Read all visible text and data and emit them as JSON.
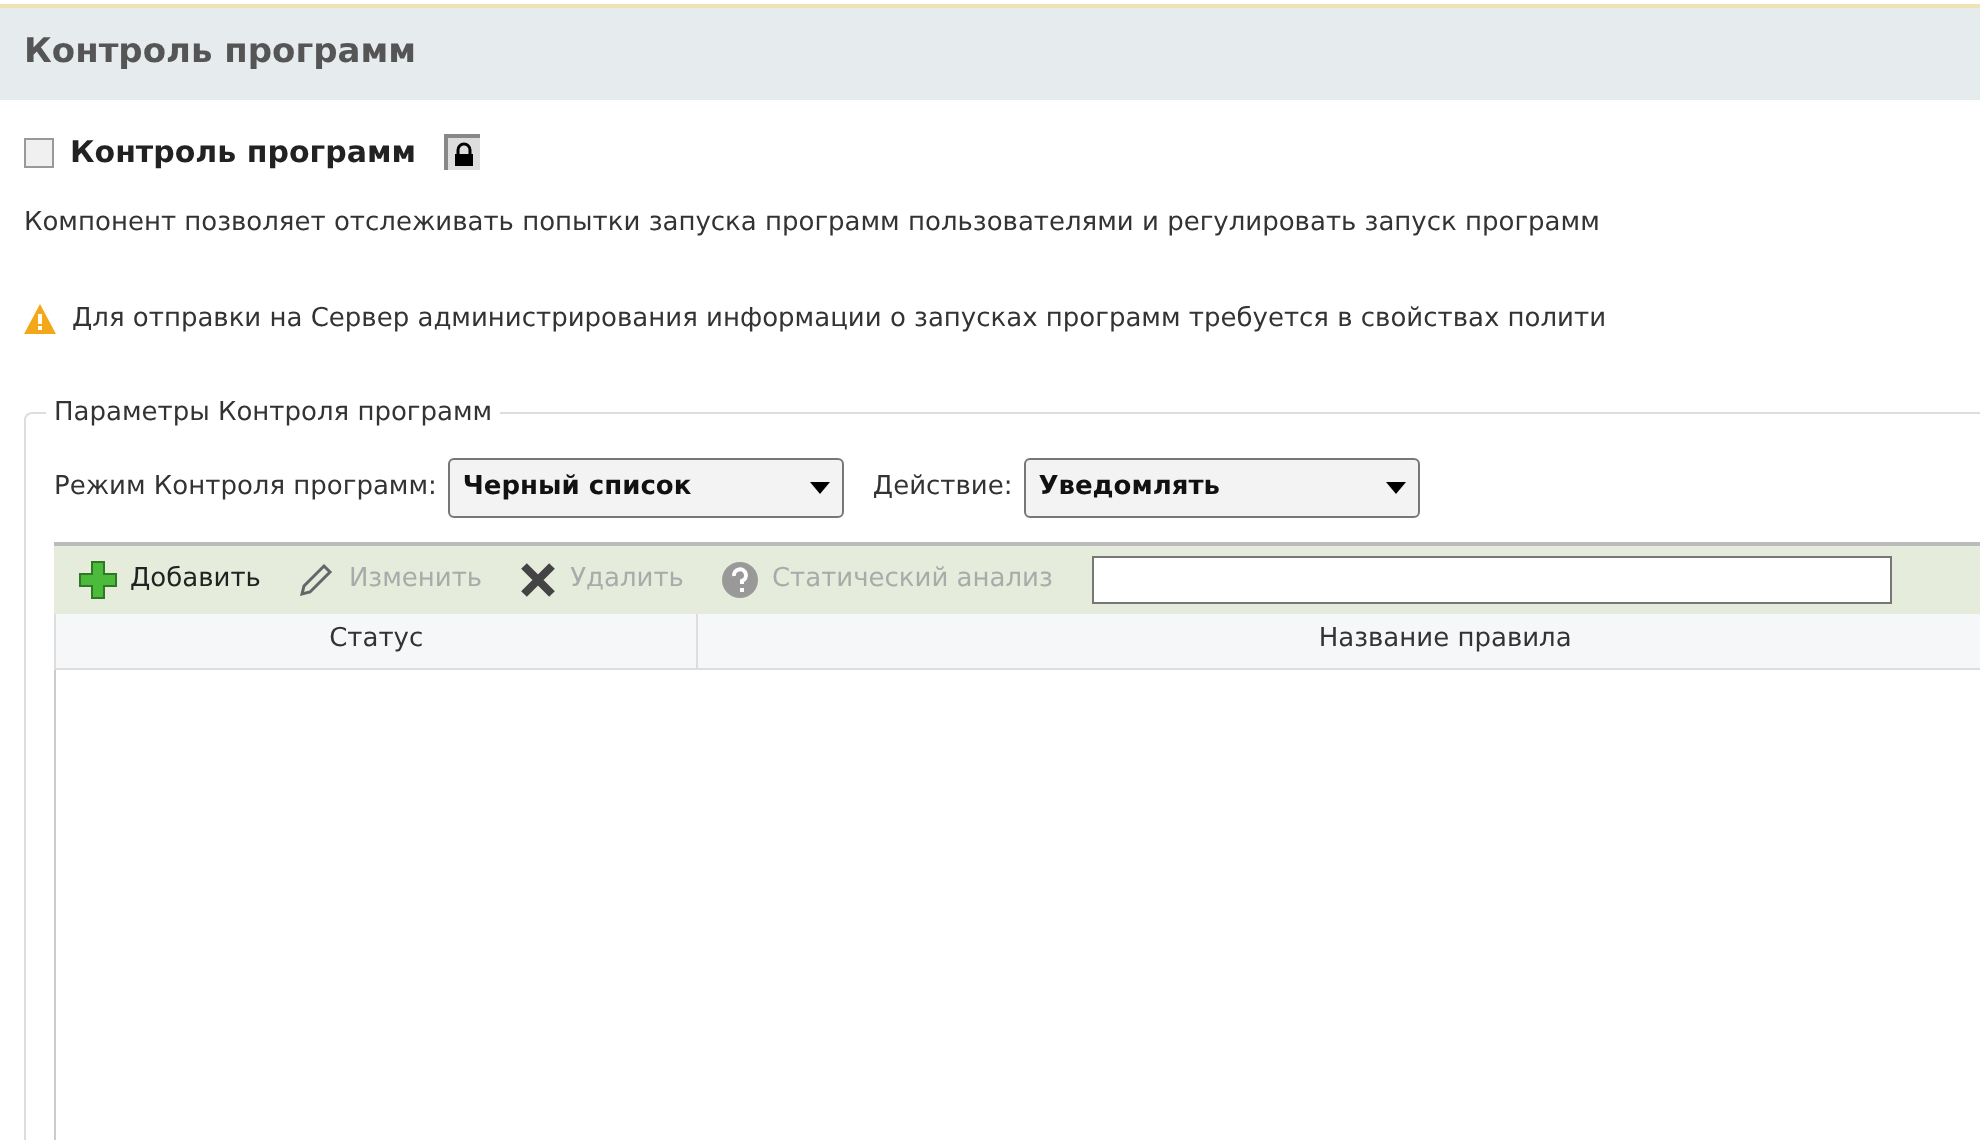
{
  "page_title": "Контроль программ",
  "component": {
    "label": "Контроль программ",
    "checked": false,
    "locked": true
  },
  "description": "Компонент позволяет отслеживать попытки запуска программ пользователями и регулировать запуск программ",
  "warning": "Для отправки на Сервер администрирования информации о запусках программ требуется в свойствах полити",
  "group": {
    "legend": "Параметры Контроля программ",
    "mode": {
      "label": "Режим Контроля программ:",
      "value": "Черный список"
    },
    "action": {
      "label": "Действие:",
      "value": "Уведомлять"
    },
    "toolbar": [
      {
        "kind": "add",
        "label": "Добавить",
        "disabled": false
      },
      {
        "kind": "edit",
        "label": "Изменить",
        "disabled": true
      },
      {
        "kind": "delete",
        "label": "Удалить",
        "disabled": true
      },
      {
        "kind": "help",
        "label": "Статический анализ",
        "disabled": true
      }
    ],
    "table": {
      "columns": [
        "Статус",
        "Название правила"
      ]
    }
  }
}
